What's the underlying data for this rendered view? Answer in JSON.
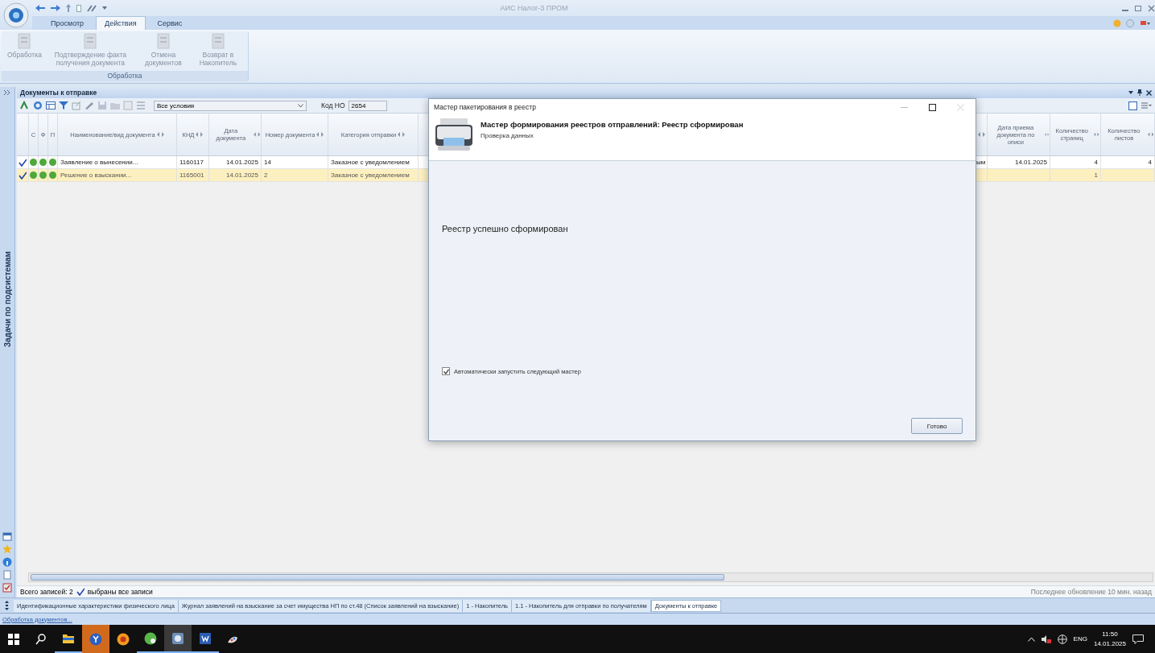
{
  "window": {
    "title": "АИС Налог-3 ПРОМ"
  },
  "ribbon": {
    "tabs": [
      {
        "label": "Просмотр",
        "selected": false
      },
      {
        "label": "Действия",
        "selected": true
      },
      {
        "label": "Сервис",
        "selected": false
      }
    ],
    "groups": [
      {
        "title": "Обработка",
        "buttons": [
          {
            "label": "Обработка",
            "disabled": true
          },
          {
            "label": "Подтверждение факта получения документа",
            "disabled": true
          },
          {
            "label": "Отмена документов",
            "disabled": true
          },
          {
            "label": "Возврат в Накопитель",
            "disabled": true
          }
        ]
      }
    ]
  },
  "side_panel": {
    "title": "Задачи по подсистемам"
  },
  "documents_panel": {
    "title": "Документы к отправке",
    "filter": {
      "value": "Все условия"
    },
    "tax_office": {
      "label": "Код НО",
      "value": "2654"
    },
    "table": {
      "status_columns": [
        "С",
        "Ф",
        "П"
      ],
      "columns": [
        "Наименование/вид документа",
        "КНД",
        "Дата документа",
        "Номер документа",
        "Категория отправки"
      ],
      "right_columns": [
        "Дата приема документа по описи",
        "Количество страниц",
        "Количество листов"
      ],
      "rows": [
        {
          "checked": true,
          "selected": false,
          "cells": [
            "Заявление о вынесении...",
            "1160117",
            "14.01.2025",
            "14",
            "Заказное с уведомлением"
          ],
          "column_9": "ым",
          "right_cells": [
            "14.01.2025",
            "4",
            "4"
          ]
        },
        {
          "checked": true,
          "selected": true,
          "cells": [
            "Решение о взыскании...",
            "1165001",
            "14.01.2025",
            "2",
            "Заказное с уведомлением"
          ],
          "right_cells": [
            null,
            "1",
            null
          ]
        }
      ]
    },
    "status": {
      "total": "Всего записей: 2",
      "all_selected": {
        "label": "выбраны все записи",
        "checked": true
      },
      "last_update": "Последнее обновление 10 мин. назад"
    }
  },
  "bottom_tabs": [
    {
      "label": "Идентификационные характеристики физического лица",
      "selected": false
    },
    {
      "label": "Журнал заявлений на взыскание за счет имущества НП по ст.48 (Список заявлений на взыскание)",
      "selected": false
    },
    {
      "label": "1 - Накопитель",
      "selected": false
    },
    {
      "label": "1.1 - Накопитель для отправки по получателям",
      "selected": false
    },
    {
      "label": "Документы к отправке",
      "selected": true
    }
  ],
  "status_line": "Обработка документов...",
  "taskbar": {
    "language": "ENG",
    "time": "11:50",
    "date": "14.01.2025"
  },
  "dialog": {
    "title": "Мастер пакетирования в реестр",
    "heading": "Мастер формирования реестров отправлений: Реестр сформирован",
    "subheading": "Проверка данных",
    "message": "Реестр успешно сформирован",
    "auto_start": {
      "label": "Автоматически запустить следующий мастер",
      "checked": true
    },
    "button": "Готово"
  }
}
